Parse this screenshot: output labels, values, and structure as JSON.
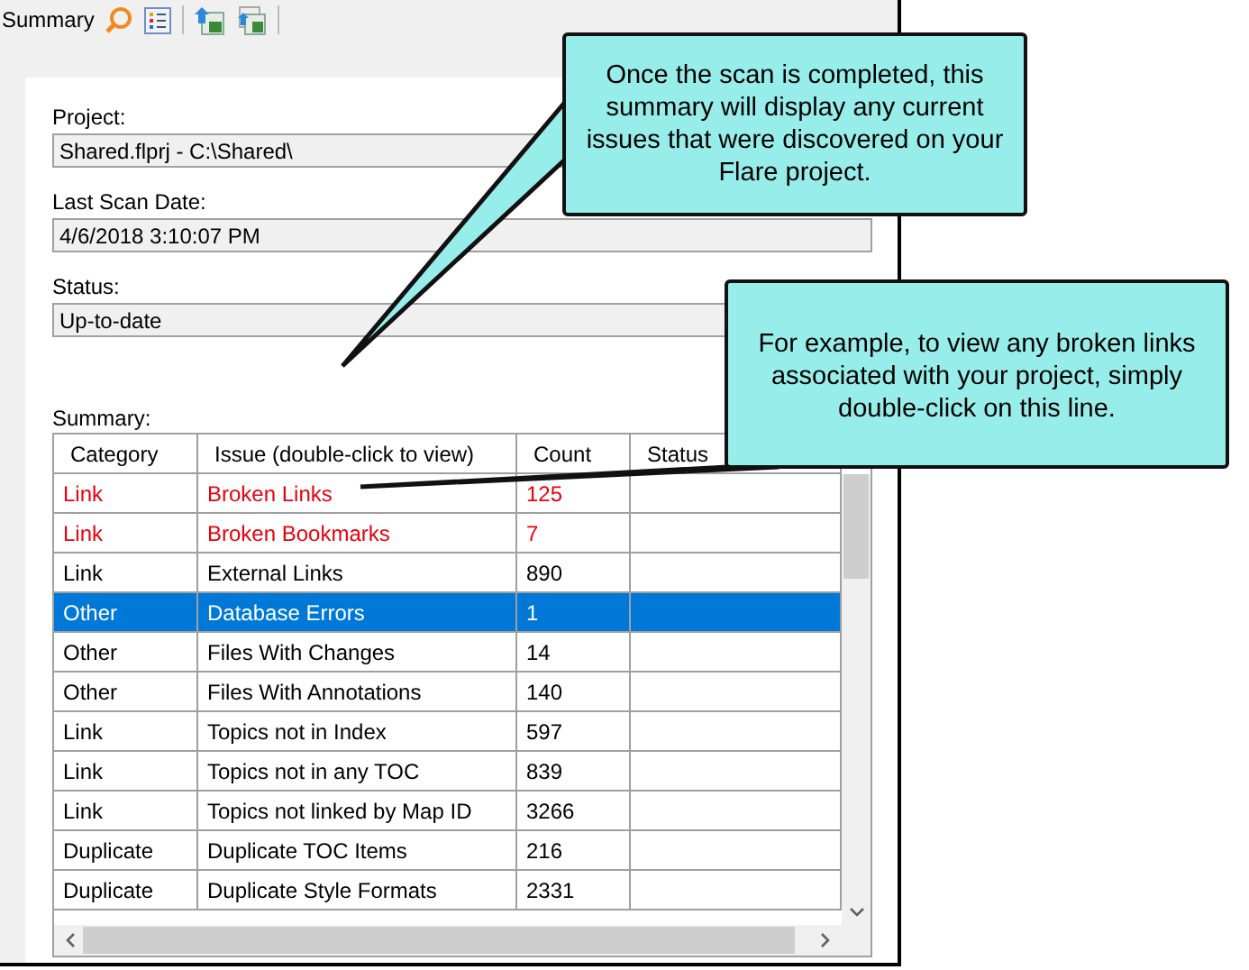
{
  "toolbar": {
    "title": "Summary"
  },
  "fields": [
    {
      "label": "Project:",
      "value": "Shared.flprj - C:\\Shared\\"
    },
    {
      "label": "Last Scan Date:",
      "value": "4/6/2018 3:10:07 PM"
    },
    {
      "label": "Status:",
      "value": "Up-to-date"
    }
  ],
  "summary": {
    "label": "Summary:",
    "columns": [
      "Category",
      "Issue (double-click to view)",
      "Count",
      "Status"
    ],
    "rows": [
      {
        "category": "Link",
        "issue": "Broken Links",
        "count": "125",
        "error": true,
        "selected": false
      },
      {
        "category": "Link",
        "issue": "Broken Bookmarks",
        "count": "7",
        "error": true,
        "selected": false
      },
      {
        "category": "Link",
        "issue": "External Links",
        "count": "890",
        "error": false,
        "selected": false
      },
      {
        "category": "Other",
        "issue": "Database Errors",
        "count": "1",
        "error": false,
        "selected": true
      },
      {
        "category": "Other",
        "issue": "Files With Changes",
        "count": "14",
        "error": false,
        "selected": false
      },
      {
        "category": "Other",
        "issue": "Files With Annotations",
        "count": "140",
        "error": false,
        "selected": false
      },
      {
        "category": "Link",
        "issue": "Topics not in Index",
        "count": "597",
        "error": false,
        "selected": false
      },
      {
        "category": "Link",
        "issue": "Topics not in any TOC",
        "count": "839",
        "error": false,
        "selected": false
      },
      {
        "category": "Link",
        "issue": "Topics not linked by Map ID",
        "count": "3266",
        "error": false,
        "selected": false
      },
      {
        "category": "Duplicate",
        "issue": "Duplicate TOC Items",
        "count": "216",
        "error": false,
        "selected": false
      },
      {
        "category": "Duplicate",
        "issue": "Duplicate Style Formats",
        "count": "2331",
        "error": false,
        "selected": false
      }
    ]
  },
  "callouts": [
    {
      "text": "Once the scan is completed, this summary will display any current issues that were discovered on your Flare project."
    },
    {
      "text": "For example, to view any broken links associated with your project, simply double-click on this line."
    }
  ]
}
